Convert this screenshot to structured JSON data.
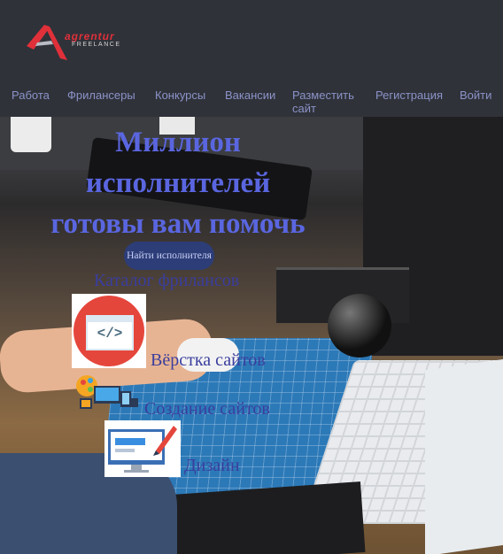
{
  "header": {
    "logo": {
      "brand_top": "agrentur",
      "brand_bottom": "FREELANCE"
    },
    "nav": [
      {
        "label": "Работа"
      },
      {
        "label": "Фрилансеры"
      },
      {
        "label": "Конкурсы"
      },
      {
        "label": "Вакансии"
      },
      {
        "label": "Разместить сайт"
      },
      {
        "label": "Регистрация"
      },
      {
        "label": "Войти"
      }
    ]
  },
  "hero": {
    "title_lines": [
      "Миллион",
      "исполнителей",
      "готовы вам помочь"
    ],
    "find_button": "Найти исполнителя"
  },
  "catalog": {
    "title": "Каталог фрилансов",
    "items": [
      {
        "label": "Вёрстка сайтов",
        "icon": "code-window-icon"
      },
      {
        "label": "Создание сайтов",
        "icon": "web-devices-icon"
      },
      {
        "label": "Дизайн",
        "icon": "design-pen-icon"
      }
    ]
  },
  "colors": {
    "header_bg": "#2f3239",
    "nav_text": "#8c93c8",
    "hero_title": "#5a66e0",
    "catalog_text": "#3a3e9e",
    "button_bg": "#2c3d78",
    "logo_red": "#e0303a"
  }
}
